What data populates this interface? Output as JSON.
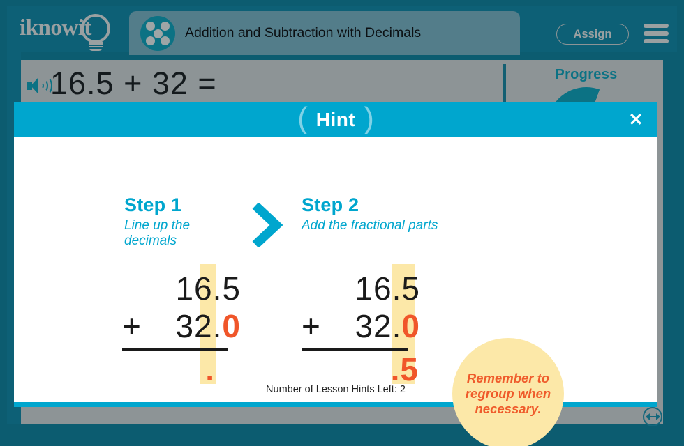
{
  "header": {
    "logo_text": "iknowit",
    "logo_icon": "lightbulb-icon",
    "subject_icon": "five-dots-circle-icon",
    "lesson_title": "Addition and Subtraction with Decimals",
    "assign_label": "Assign",
    "menu_icon": "hamburger-menu-icon"
  },
  "question": {
    "speaker_icon": "speaker-audio-icon",
    "text": "16.5 + 32 ="
  },
  "progress": {
    "label": "Progress",
    "percent": 30
  },
  "footer": {
    "resize_icon": "resize-horizontal-icon"
  },
  "modal": {
    "title": "Hint",
    "paren_left": "(",
    "paren_right": ")",
    "close_icon": "close-x-icon",
    "hints_left_text": "Number of Lesson Hints Left: 2",
    "chevron_icon": "chevron-right-icon",
    "steps": [
      {
        "title": "Step 1",
        "subtitle": "Line up the decimals",
        "addend1": "16.5",
        "addend2_sign": "+",
        "addend2_whole": "32.",
        "addend2_extra": "0",
        "answer": ".",
        "highlight": "decimal-point-column"
      },
      {
        "title": "Step 2",
        "subtitle": "Add the fractional parts",
        "addend1": "16.5",
        "addend2_sign": "+",
        "addend2_whole": "32.",
        "addend2_extra": "0",
        "answer": ".5",
        "highlight": "tenths-column"
      }
    ],
    "note": "Remember to regroup when necessary."
  },
  "colors": {
    "frame_teal": "#0c5c70",
    "bar_teal": "#0d6076",
    "tab_slate": "#537d8a",
    "content_gray": "#8d9496",
    "accent_cyan": "#00a6ce",
    "accent_orange": "#f0562a",
    "highlight_yellow": "#fce8a8"
  }
}
